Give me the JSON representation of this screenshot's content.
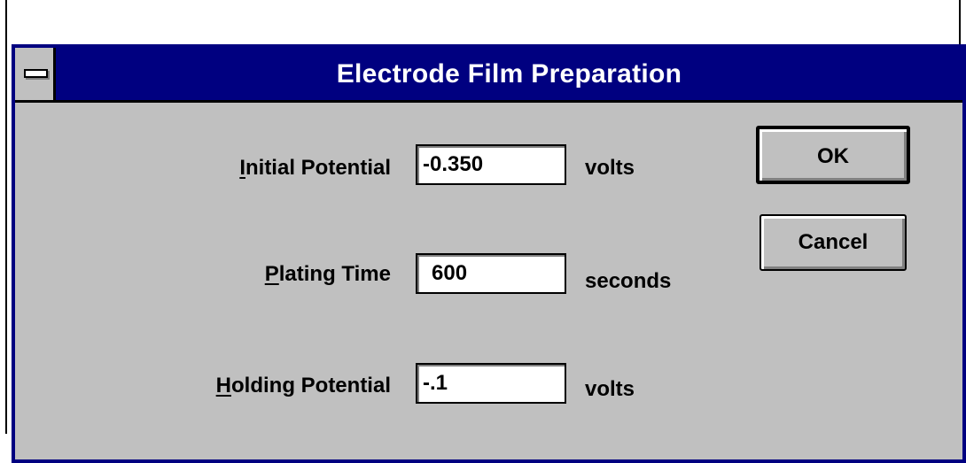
{
  "dialog": {
    "title": "Electrode Film Preparation",
    "system_menu_icon": "system-menu-dash-icon"
  },
  "fields": {
    "initial_potential": {
      "label_mnemonic": "I",
      "label_rest": "nitial Potential",
      "value": "-0.350",
      "unit": "volts"
    },
    "plating_time": {
      "label_mnemonic": "P",
      "label_rest": "lating Time",
      "value": "600",
      "unit": "seconds"
    },
    "holding_potential": {
      "label_mnemonic": "H",
      "label_rest": "olding Potential",
      "value": "-.1",
      "unit": "volts"
    }
  },
  "buttons": {
    "ok": "OK",
    "cancel": "Cancel"
  },
  "colors": {
    "titlebar": "#000080",
    "dialog_face": "#c0c0c0",
    "title_text": "#ffffff"
  }
}
